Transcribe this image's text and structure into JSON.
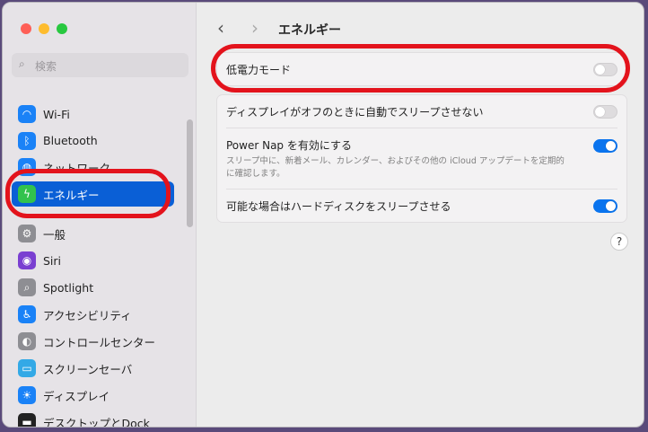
{
  "sidebar": {
    "search_placeholder": "検索",
    "items": [
      {
        "label": "Wi-Fi",
        "icon": "wifi-icon",
        "color": "#1a82f7"
      },
      {
        "label": "Bluetooth",
        "icon": "bluetooth-icon",
        "color": "#1a82f7"
      },
      {
        "label": "ネットワーク",
        "icon": "globe-icon",
        "color": "#1a82f7"
      },
      {
        "label": "エネルギー",
        "icon": "bolt-icon",
        "color": "#32c24d",
        "selected": true
      },
      {
        "label": "一般",
        "icon": "gear-icon",
        "color": "#8e8e93"
      },
      {
        "label": "Siri",
        "icon": "siri-icon",
        "color": "#7a3fd1"
      },
      {
        "label": "Spotlight",
        "icon": "magnifier-icon",
        "color": "#8e8e93"
      },
      {
        "label": "アクセシビリティ",
        "icon": "accessibility-icon",
        "color": "#1a82f7"
      },
      {
        "label": "コントロールセンター",
        "icon": "toggles-icon",
        "color": "#8e8e93"
      },
      {
        "label": "スクリーンセーバ",
        "icon": "screensaver-icon",
        "color": "#33a9e6"
      },
      {
        "label": "ディスプレイ",
        "icon": "sun-icon",
        "color": "#1a82f7"
      },
      {
        "label": "デスクトップとDock",
        "icon": "dock-icon",
        "color": "#222222"
      }
    ]
  },
  "header": {
    "title": "エネルギー",
    "back": "‹",
    "forward": "›"
  },
  "settings": {
    "low_power": {
      "label": "低電力モード",
      "on": false
    },
    "no_sleep": {
      "label": "ディスプレイがオフのときに自動でスリープさせない",
      "on": false
    },
    "power_nap": {
      "label": "Power Nap を有効にする",
      "description": "スリープ中に、新着メール、カレンダー、およびその他の iCloud アップデートを定期的に確認します。",
      "on": true
    },
    "disk_sleep": {
      "label": "可能な場合はハードディスクをスリープさせる",
      "on": true
    }
  },
  "help": "?"
}
